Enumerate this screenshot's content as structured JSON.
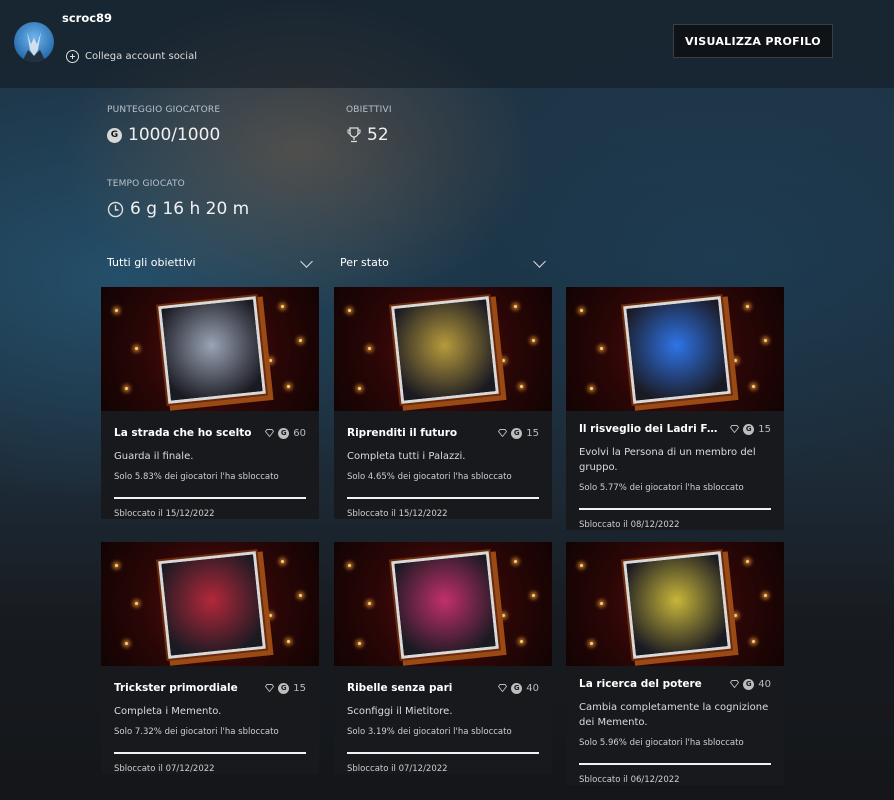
{
  "header": {
    "username": "scroc89",
    "social_link": "Collega account social",
    "profile_button": "VISUALIZZA PROFILO"
  },
  "stats": {
    "score_label": "PUNTEGGIO GIOCATORE",
    "score_value": "1000/1000",
    "achievements_label": "OBIETTIVI",
    "achievements_value": "52",
    "time_label": "TEMPO GIOCATO",
    "time_value": "6 g 16 h 20 m"
  },
  "filters": {
    "all": "Tutti gli obiettivi",
    "state": "Per stato"
  },
  "gamerscore_letter": "G",
  "cards": [
    {
      "title": "La strada che ho scelto",
      "points": "60",
      "desc": "Guarda il finale.",
      "rarity": "Solo 5.83% dei giocatori l'ha sbloccato",
      "date": "Sbloccato il 15/12/2022",
      "art_color": "#9aa4b5"
    },
    {
      "title": "Riprenditi il futuro",
      "points": "15",
      "desc": "Completa tutti i Palazzi.",
      "rarity": "Solo 4.65% dei giocatori l'ha sbloccato",
      "date": "Sbloccato il 15/12/2022",
      "art_color": "#b79a3c"
    },
    {
      "title": "Il risveglio dei Ladri Fanta...",
      "points": "15",
      "desc": "Evolvi la Persona di un membro del gruppo.",
      "rarity": "Solo 5.77% dei giocatori l'ha sbloccato",
      "date": "Sbloccato il 08/12/2022",
      "art_color": "#2f74e8"
    },
    {
      "title": "Trickster primordiale",
      "points": "15",
      "desc": "Completa i Memento.",
      "rarity": "Solo 7.32% dei giocatori l'ha sbloccato",
      "date": "Sbloccato il 07/12/2022",
      "art_color": "#b3283a"
    },
    {
      "title": "Ribelle senza pari",
      "points": "40",
      "desc": "Sconfiggi il Mietitore.",
      "rarity": "Solo 3.19% dei giocatori l'ha sbloccato",
      "date": "Sbloccato il 07/12/2022",
      "art_color": "#c2306a"
    },
    {
      "title": "La ricerca del potere",
      "points": "40",
      "desc": "Cambia completamente la cognizione dei Memento.",
      "rarity": "Solo 5.96% dei giocatori l'ha sbloccato",
      "date": "Sbloccato il 06/12/2022",
      "art_color": "#c8b63a"
    }
  ]
}
